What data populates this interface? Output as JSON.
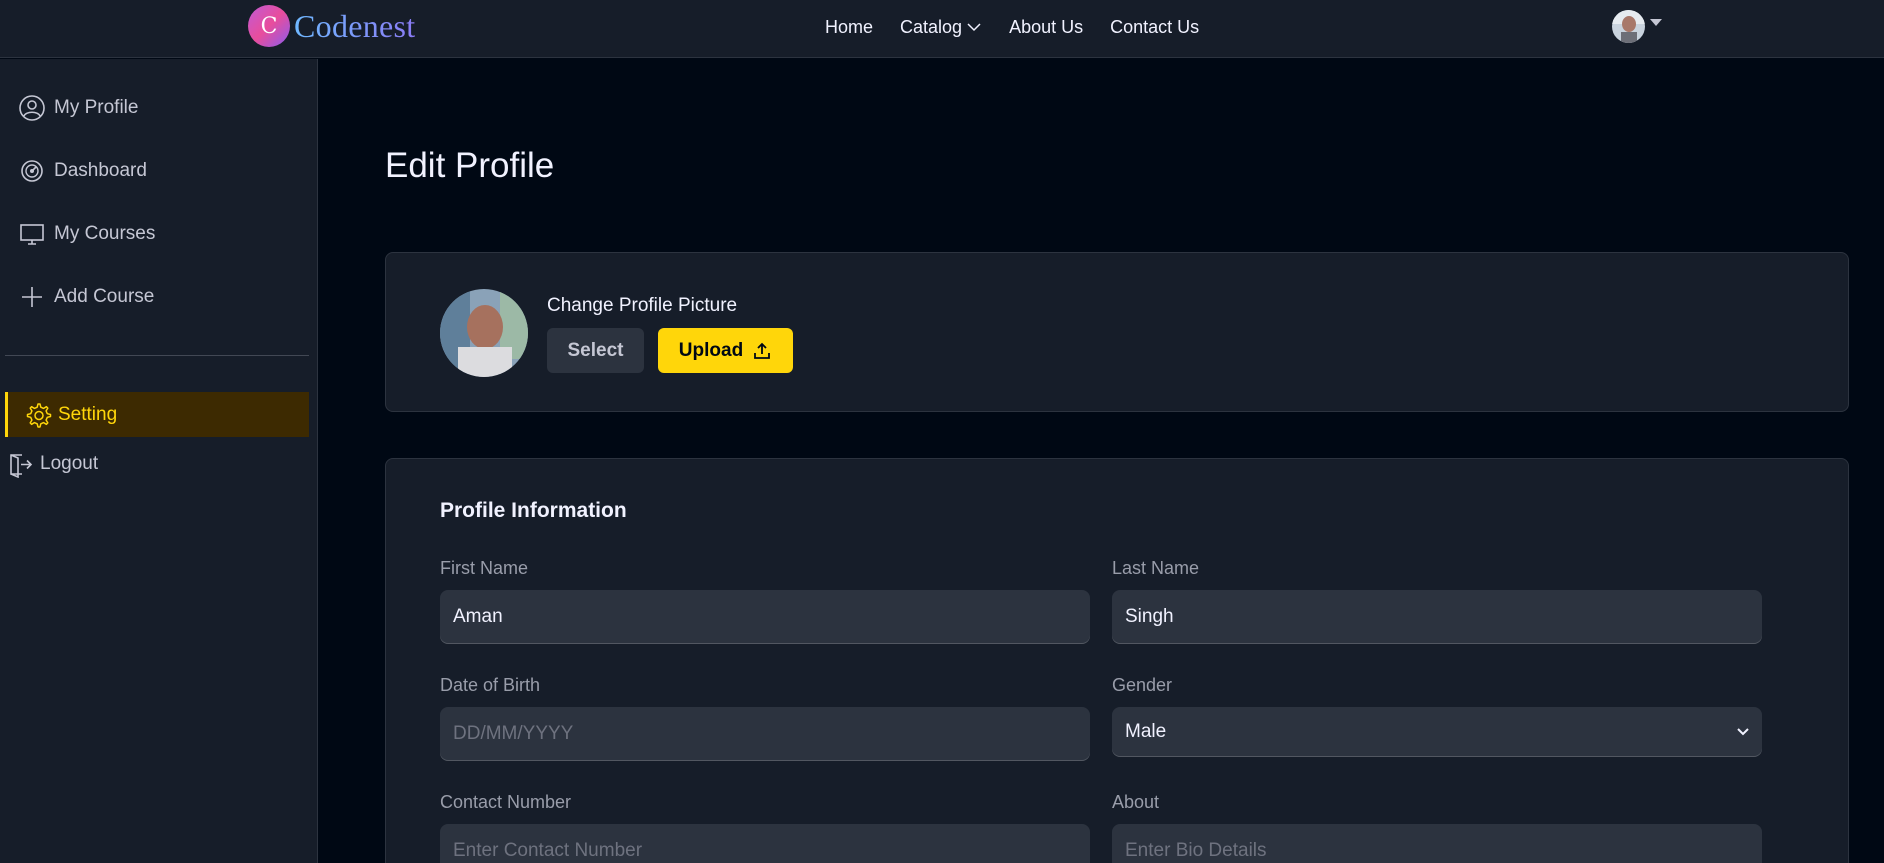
{
  "brand": {
    "logo_letter": "C",
    "name": "Codenest"
  },
  "nav": {
    "items": [
      {
        "label": "Home"
      },
      {
        "label": "Catalog",
        "has_dropdown": true
      },
      {
        "label": "About Us"
      },
      {
        "label": "Contact Us"
      }
    ]
  },
  "sidebar": {
    "items": [
      {
        "label": "My Profile",
        "icon": "user-circle-icon"
      },
      {
        "label": "Dashboard",
        "icon": "gauge-icon"
      },
      {
        "label": "My Courses",
        "icon": "monitor-icon"
      },
      {
        "label": "Add Course",
        "icon": "plus-icon"
      }
    ],
    "setting_label": "Setting",
    "logout_label": "Logout"
  },
  "page": {
    "title": "Edit Profile"
  },
  "picture_card": {
    "label": "Change Profile Picture",
    "select_label": "Select",
    "upload_label": "Upload"
  },
  "profile_info": {
    "title": "Profile Information",
    "first_name": {
      "label": "First Name",
      "value": "Aman"
    },
    "last_name": {
      "label": "Last Name",
      "value": "Singh"
    },
    "dob": {
      "label": "Date of Birth",
      "placeholder": "DD/MM/YYYY"
    },
    "gender": {
      "label": "Gender",
      "value": "Male"
    },
    "contact": {
      "label": "Contact Number",
      "placeholder": "Enter Contact Number"
    },
    "about": {
      "label": "About",
      "placeholder": "Enter Bio Details"
    }
  },
  "colors": {
    "accent": "#ffd60a",
    "active_bg": "#3d2a01",
    "background": "#000814",
    "panel": "#161d29",
    "field": "#2c333f"
  }
}
